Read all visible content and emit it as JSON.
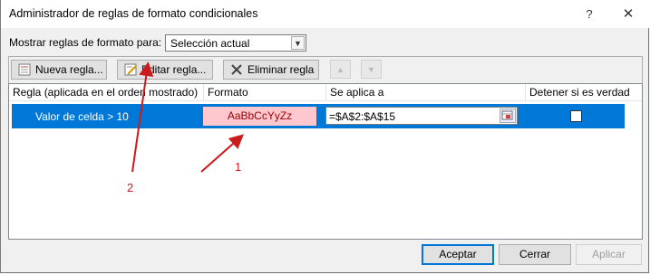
{
  "window": {
    "title": "Administrador de reglas de formato condicionales",
    "help_glyph": "?",
    "close_glyph": "✕"
  },
  "show_rules": {
    "label": "Mostrar reglas de formato para:",
    "selected": "Selección actual"
  },
  "toolbar": {
    "new_rule": "Nueva regla...",
    "edit_rule": "Editar regla...",
    "delete_rule": "Eliminar regla"
  },
  "table": {
    "headers": [
      "Regla (aplicada en el orden mostrado)",
      "Formato",
      "Se aplica a",
      "Detener si es verdad"
    ],
    "rows": [
      {
        "rule": "Valor de celda > 10",
        "format_preview": "AaBbCcYyZz",
        "applies_to": "=$A$2:$A$15",
        "stop_if_true": false
      }
    ]
  },
  "footer": {
    "accept": "Aceptar",
    "cancel": "Cerrar",
    "apply": "Aplicar"
  },
  "annotations": [
    "1",
    "2"
  ],
  "colors": {
    "selection": "#0078d7",
    "preview_fill": "#ffc7ce",
    "preview_text": "#9c0006",
    "annotation": "#cc1b1b"
  }
}
